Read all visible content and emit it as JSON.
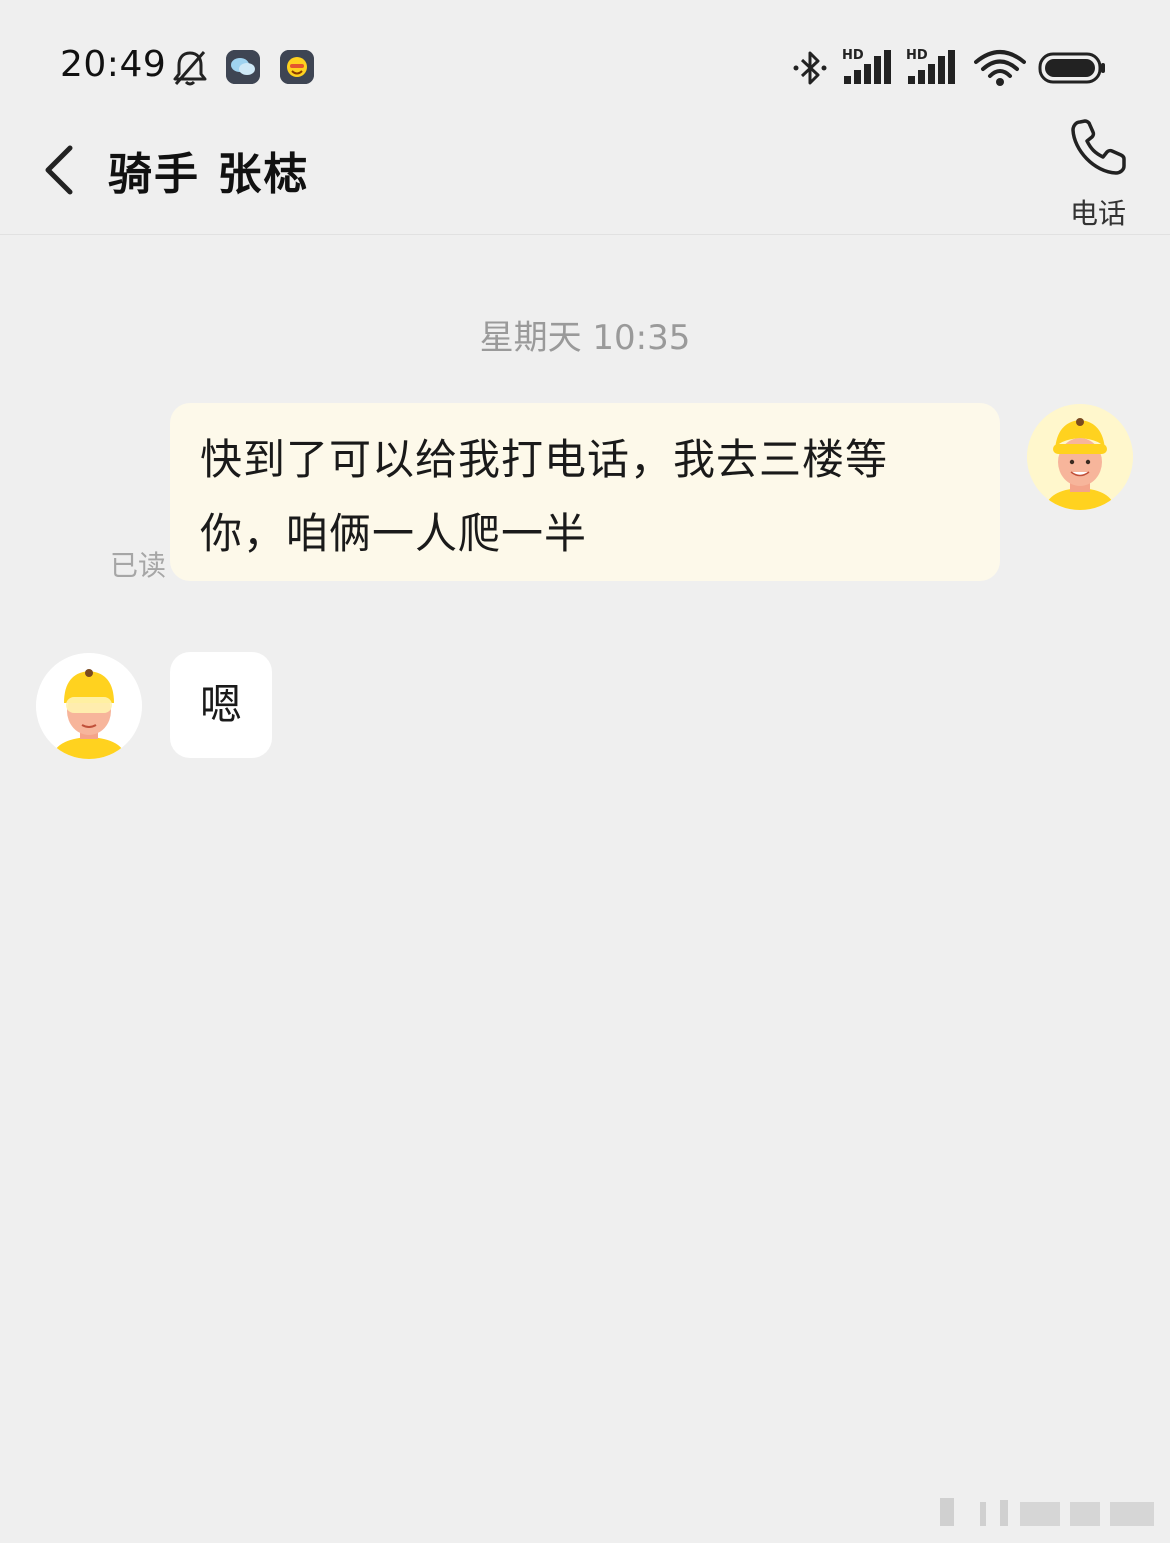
{
  "status_bar": {
    "time": "20:49",
    "icons": [
      "bell-muted-icon",
      "app-notification-icon",
      "app-notification-icon",
      "bluetooth-icon",
      "hd-signal-icon",
      "hd-signal-icon",
      "wifi-icon",
      "battery-icon"
    ],
    "signal_label_1": "HD",
    "signal_label_2": "HD"
  },
  "header": {
    "title": "骑手 张梽",
    "call_label": "电话"
  },
  "chat": {
    "timestamp": "星期天 10:35",
    "messages": [
      {
        "sender": "me",
        "text_line1": "快到了可以给我打电话，我去三楼等",
        "text_line2": "你，咱俩一人爬一半",
        "read_status": "已读"
      },
      {
        "sender": "rider",
        "text": "嗯"
      }
    ]
  },
  "colors": {
    "background": "#efefef",
    "outgoing_bubble": "#fdf9ea",
    "incoming_bubble": "#ffffff",
    "accent_yellow": "#ffd21f"
  }
}
